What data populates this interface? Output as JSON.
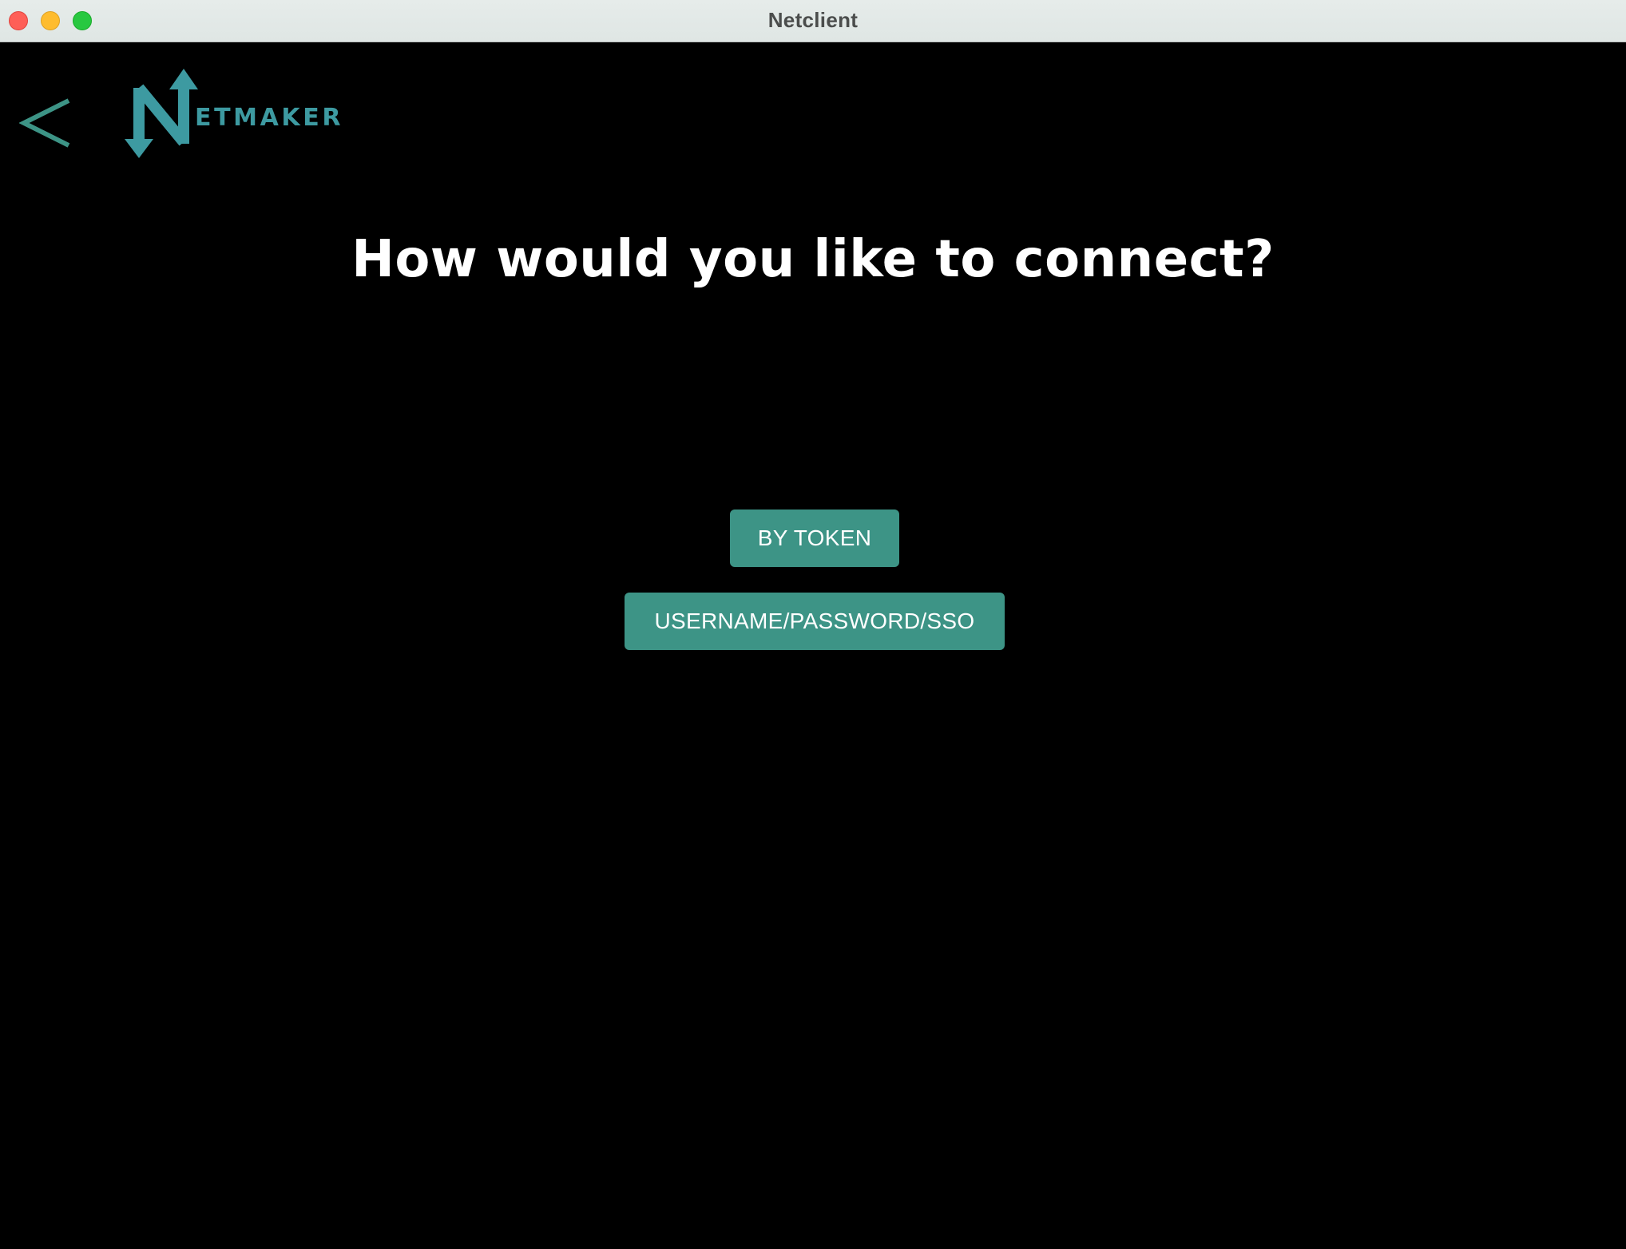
{
  "window": {
    "title": "Netclient"
  },
  "header": {
    "back_icon": "chevron-left-icon",
    "logo_text": "ETMAKER",
    "logo_icon": "netmaker-logo-icon"
  },
  "main": {
    "title": "How would you like to connect?",
    "buttons": {
      "by_token": "BY TOKEN",
      "username_password_sso": "USERNAME/PASSWORD/SSO"
    }
  },
  "colors": {
    "background": "#000000",
    "accent": "#3d9486",
    "logo": "#3d9aa1",
    "text": "#ffffff"
  }
}
